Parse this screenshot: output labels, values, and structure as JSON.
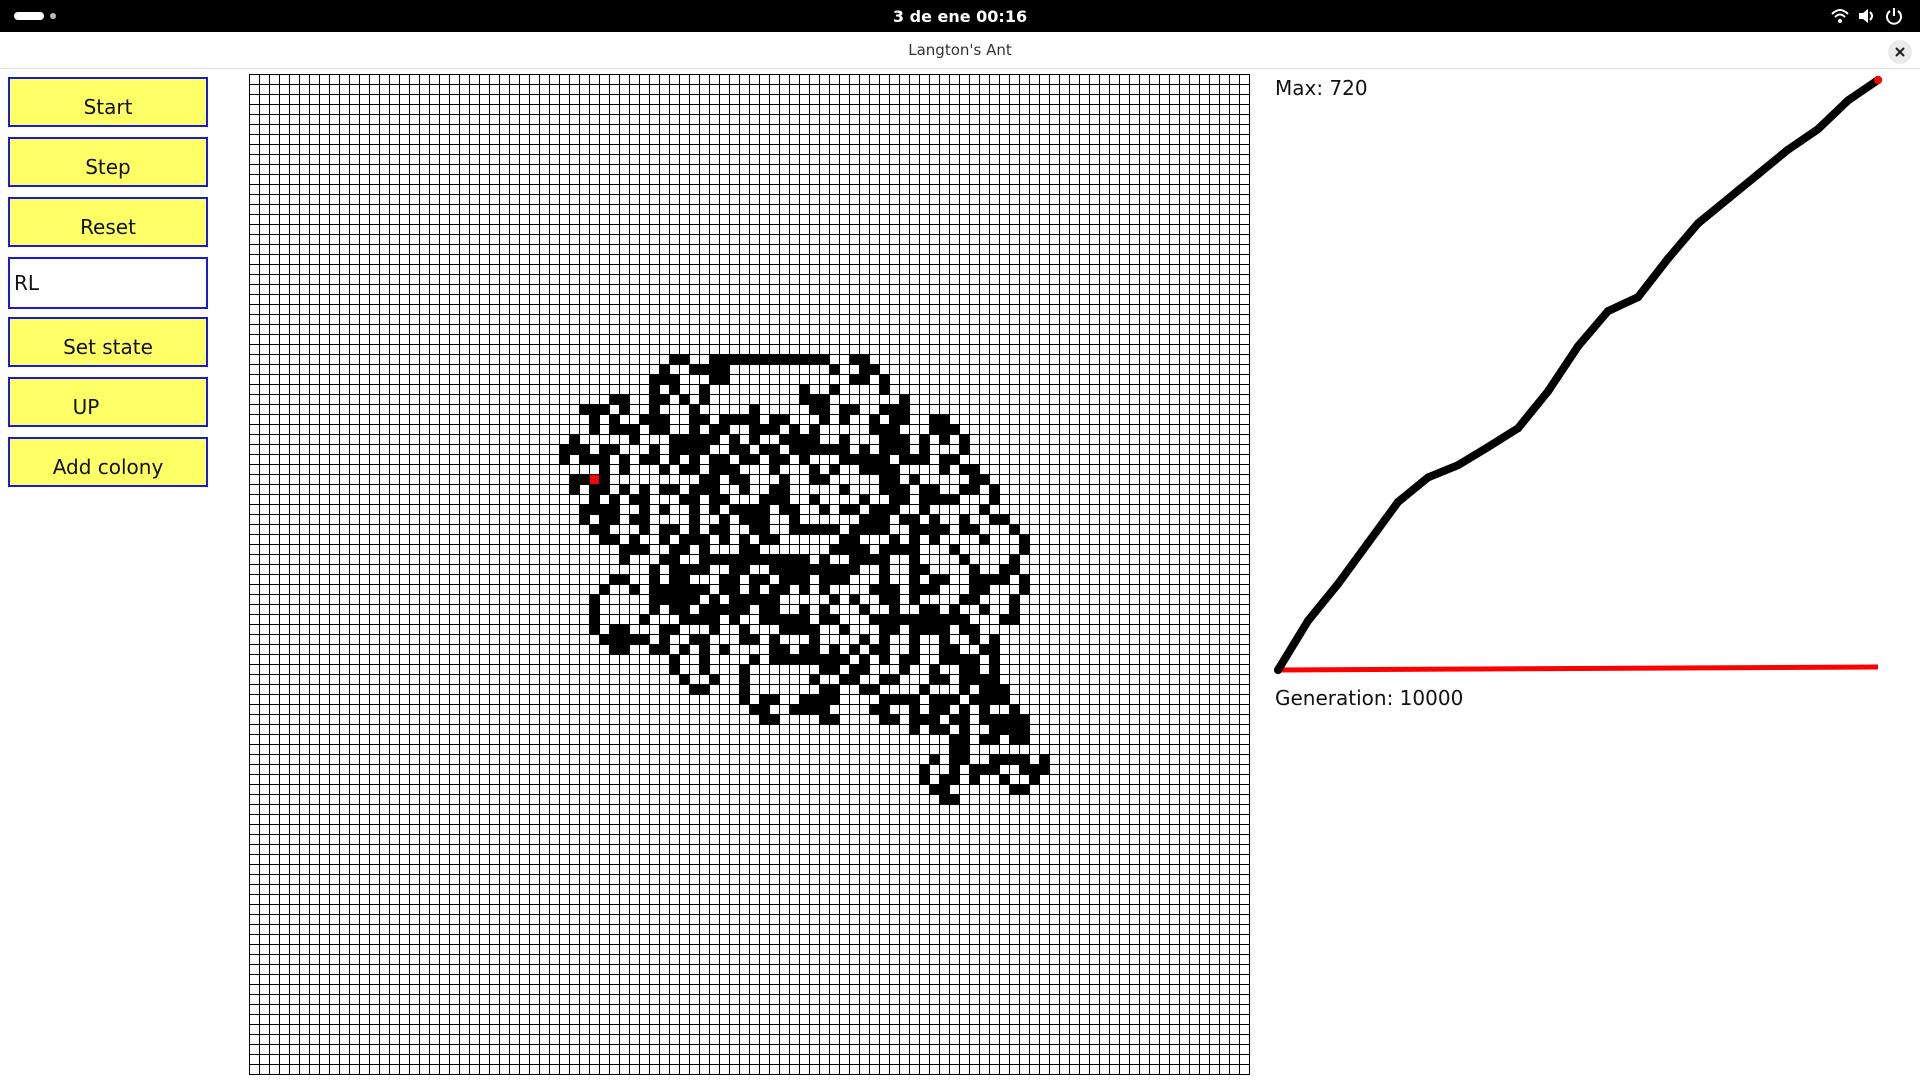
{
  "system_bar": {
    "clock": "3 de ene  00:16",
    "icons": [
      "wifi-icon",
      "volume-icon",
      "power-icon"
    ]
  },
  "window": {
    "title": "Langton's Ant",
    "close_icon": "close-icon"
  },
  "controls": {
    "start_label": "Start",
    "step_label": "Step",
    "reset_label": "Reset",
    "rule_value": "RL",
    "set_state_label": "Set state",
    "direction_label": "UP",
    "add_colony_label": "Add colony"
  },
  "stats": {
    "max_label": "Max: 720",
    "generation_label": "Generation: 10000"
  },
  "colors": {
    "button_bg": "#ffff66",
    "button_border": "#1a1adb",
    "live_cell": "#000000",
    "ant": "#ff0000",
    "grid_line": "#000000",
    "zero_line": "#ff0000"
  },
  "simulation": {
    "rule": "RL",
    "generations": 10000,
    "initial_direction": "UP",
    "ant_color": "#ff0000"
  },
  "chart_data": {
    "type": "line",
    "title": "",
    "xlabel": "",
    "ylabel": "",
    "series": [
      {
        "x": [
          0,
          500,
          1000,
          1500,
          2000,
          2500,
          3000,
          3500,
          4000,
          4500,
          5000,
          5500,
          6000,
          6500,
          7000,
          7500,
          8000,
          8500,
          9000,
          9500,
          10000
        ],
        "values": [
          0,
          60,
          105,
          155,
          205,
          235,
          250,
          272,
          295,
          340,
          395,
          438,
          455,
          502,
          545,
          575,
          605,
          635,
          660,
          695,
          720
        ]
      }
    ],
    "reference_line": {
      "value": 0,
      "color": "#ff0000"
    },
    "xlim": [
      0,
      10000
    ],
    "ylim": [
      0,
      720
    ],
    "grid": false
  }
}
